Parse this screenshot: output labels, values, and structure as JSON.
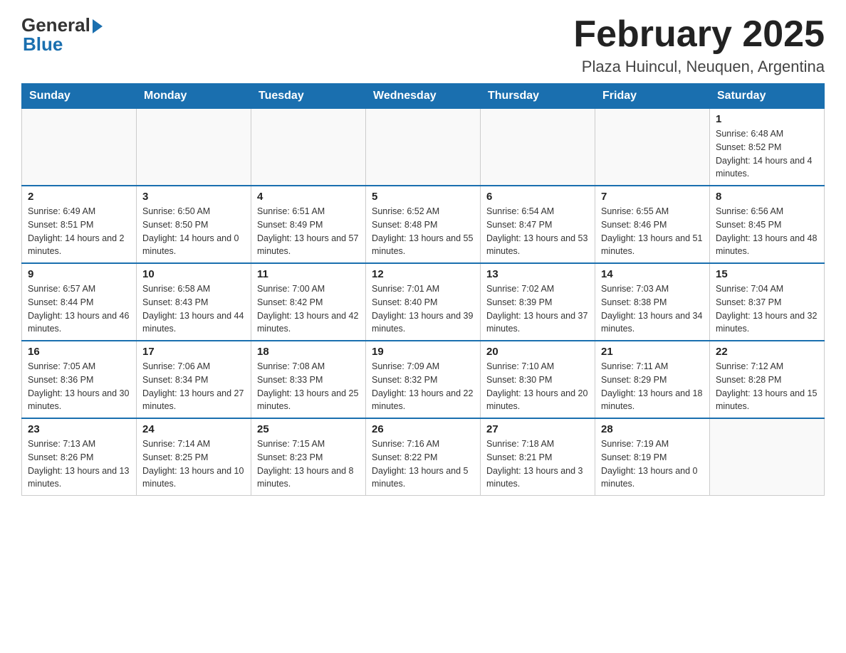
{
  "header": {
    "logo_general": "General",
    "logo_blue": "Blue",
    "month_title": "February 2025",
    "location": "Plaza Huincul, Neuquen, Argentina"
  },
  "days_of_week": [
    "Sunday",
    "Monday",
    "Tuesday",
    "Wednesday",
    "Thursday",
    "Friday",
    "Saturday"
  ],
  "weeks": [
    [
      {
        "day": "",
        "info": ""
      },
      {
        "day": "",
        "info": ""
      },
      {
        "day": "",
        "info": ""
      },
      {
        "day": "",
        "info": ""
      },
      {
        "day": "",
        "info": ""
      },
      {
        "day": "",
        "info": ""
      },
      {
        "day": "1",
        "info": "Sunrise: 6:48 AM\nSunset: 8:52 PM\nDaylight: 14 hours and 4 minutes."
      }
    ],
    [
      {
        "day": "2",
        "info": "Sunrise: 6:49 AM\nSunset: 8:51 PM\nDaylight: 14 hours and 2 minutes."
      },
      {
        "day": "3",
        "info": "Sunrise: 6:50 AM\nSunset: 8:50 PM\nDaylight: 14 hours and 0 minutes."
      },
      {
        "day": "4",
        "info": "Sunrise: 6:51 AM\nSunset: 8:49 PM\nDaylight: 13 hours and 57 minutes."
      },
      {
        "day": "5",
        "info": "Sunrise: 6:52 AM\nSunset: 8:48 PM\nDaylight: 13 hours and 55 minutes."
      },
      {
        "day": "6",
        "info": "Sunrise: 6:54 AM\nSunset: 8:47 PM\nDaylight: 13 hours and 53 minutes."
      },
      {
        "day": "7",
        "info": "Sunrise: 6:55 AM\nSunset: 8:46 PM\nDaylight: 13 hours and 51 minutes."
      },
      {
        "day": "8",
        "info": "Sunrise: 6:56 AM\nSunset: 8:45 PM\nDaylight: 13 hours and 48 minutes."
      }
    ],
    [
      {
        "day": "9",
        "info": "Sunrise: 6:57 AM\nSunset: 8:44 PM\nDaylight: 13 hours and 46 minutes."
      },
      {
        "day": "10",
        "info": "Sunrise: 6:58 AM\nSunset: 8:43 PM\nDaylight: 13 hours and 44 minutes."
      },
      {
        "day": "11",
        "info": "Sunrise: 7:00 AM\nSunset: 8:42 PM\nDaylight: 13 hours and 42 minutes."
      },
      {
        "day": "12",
        "info": "Sunrise: 7:01 AM\nSunset: 8:40 PM\nDaylight: 13 hours and 39 minutes."
      },
      {
        "day": "13",
        "info": "Sunrise: 7:02 AM\nSunset: 8:39 PM\nDaylight: 13 hours and 37 minutes."
      },
      {
        "day": "14",
        "info": "Sunrise: 7:03 AM\nSunset: 8:38 PM\nDaylight: 13 hours and 34 minutes."
      },
      {
        "day": "15",
        "info": "Sunrise: 7:04 AM\nSunset: 8:37 PM\nDaylight: 13 hours and 32 minutes."
      }
    ],
    [
      {
        "day": "16",
        "info": "Sunrise: 7:05 AM\nSunset: 8:36 PM\nDaylight: 13 hours and 30 minutes."
      },
      {
        "day": "17",
        "info": "Sunrise: 7:06 AM\nSunset: 8:34 PM\nDaylight: 13 hours and 27 minutes."
      },
      {
        "day": "18",
        "info": "Sunrise: 7:08 AM\nSunset: 8:33 PM\nDaylight: 13 hours and 25 minutes."
      },
      {
        "day": "19",
        "info": "Sunrise: 7:09 AM\nSunset: 8:32 PM\nDaylight: 13 hours and 22 minutes."
      },
      {
        "day": "20",
        "info": "Sunrise: 7:10 AM\nSunset: 8:30 PM\nDaylight: 13 hours and 20 minutes."
      },
      {
        "day": "21",
        "info": "Sunrise: 7:11 AM\nSunset: 8:29 PM\nDaylight: 13 hours and 18 minutes."
      },
      {
        "day": "22",
        "info": "Sunrise: 7:12 AM\nSunset: 8:28 PM\nDaylight: 13 hours and 15 minutes."
      }
    ],
    [
      {
        "day": "23",
        "info": "Sunrise: 7:13 AM\nSunset: 8:26 PM\nDaylight: 13 hours and 13 minutes."
      },
      {
        "day": "24",
        "info": "Sunrise: 7:14 AM\nSunset: 8:25 PM\nDaylight: 13 hours and 10 minutes."
      },
      {
        "day": "25",
        "info": "Sunrise: 7:15 AM\nSunset: 8:23 PM\nDaylight: 13 hours and 8 minutes."
      },
      {
        "day": "26",
        "info": "Sunrise: 7:16 AM\nSunset: 8:22 PM\nDaylight: 13 hours and 5 minutes."
      },
      {
        "day": "27",
        "info": "Sunrise: 7:18 AM\nSunset: 8:21 PM\nDaylight: 13 hours and 3 minutes."
      },
      {
        "day": "28",
        "info": "Sunrise: 7:19 AM\nSunset: 8:19 PM\nDaylight: 13 hours and 0 minutes."
      },
      {
        "day": "",
        "info": ""
      }
    ]
  ]
}
